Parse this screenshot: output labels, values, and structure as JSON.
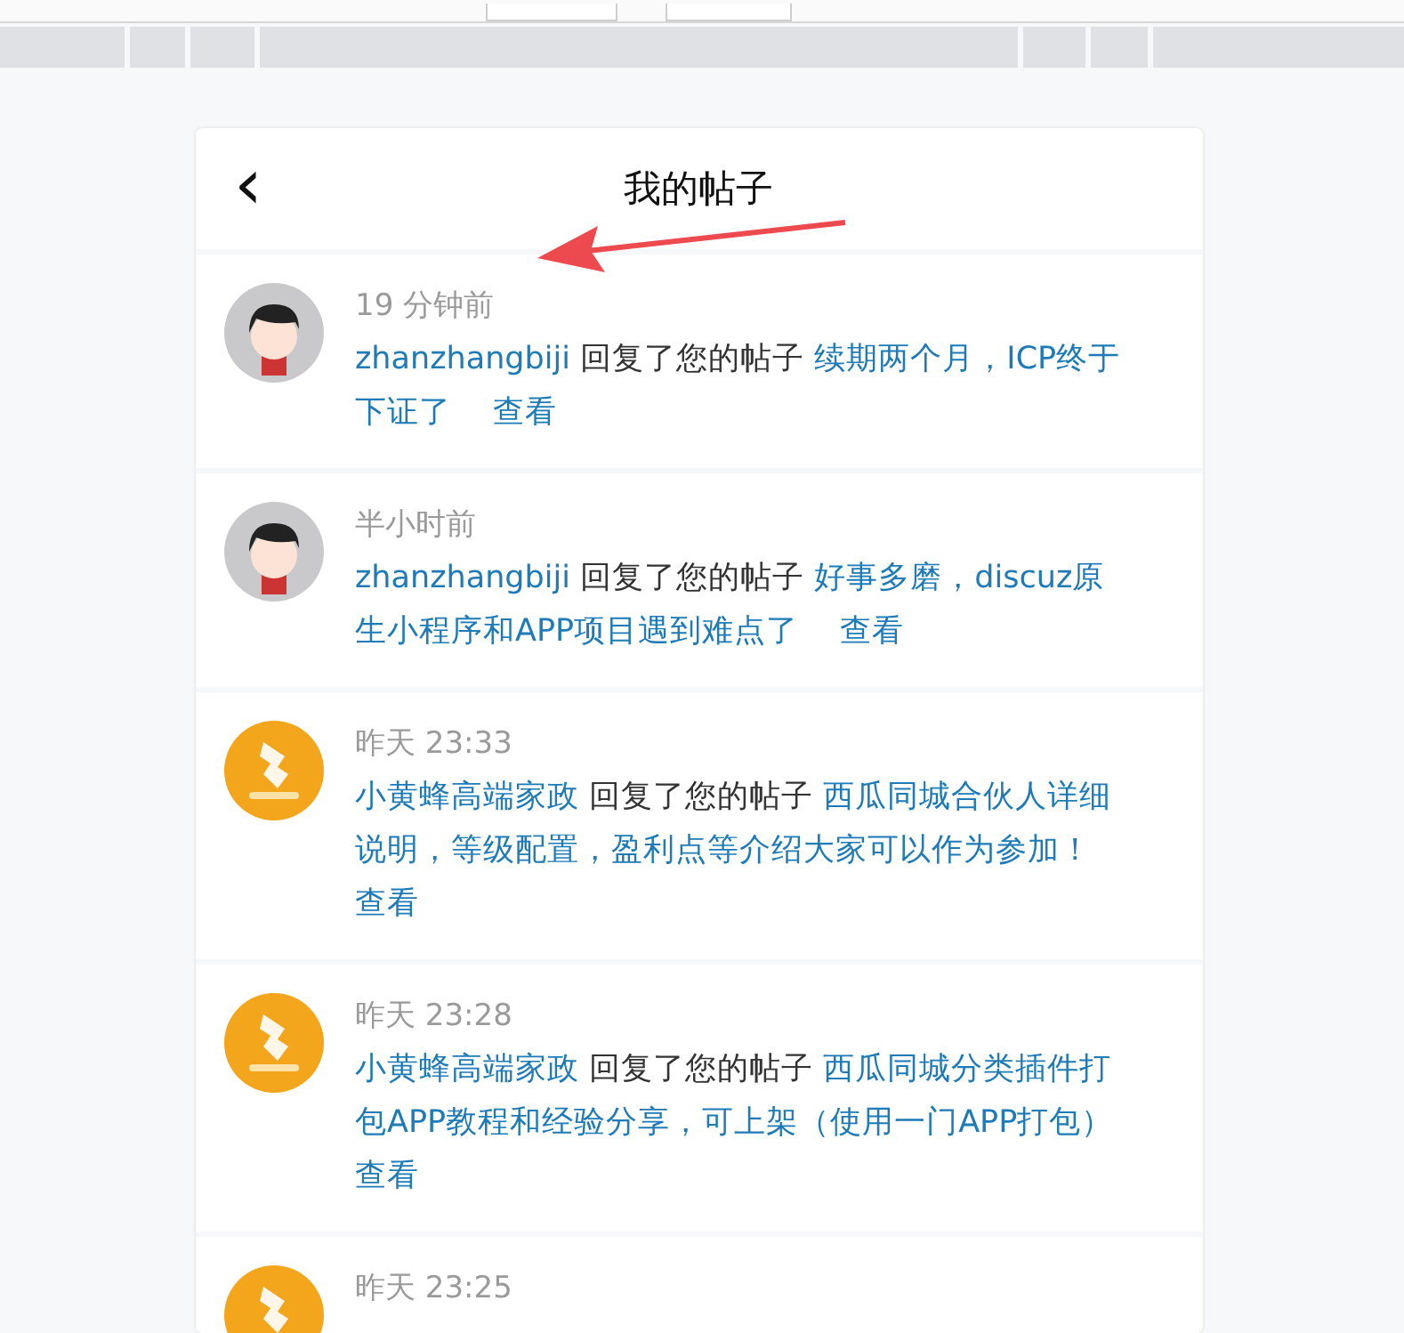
{
  "header": {
    "title": "我的帖子",
    "back": "‹"
  },
  "items": [
    {
      "kind": "cartoon",
      "time": "19 分钟前",
      "user": "zhanzhangbiji",
      "action": "回复了您的帖子",
      "post": "续期两个月，ICP终于下证了",
      "view": "查看"
    },
    {
      "kind": "cartoon",
      "time": "半小时前",
      "user": "zhanzhangbiji",
      "action": "回复了您的帖子",
      "post": "好事多磨，discuz原生小程序和APP项目遇到难点了",
      "view": "查看"
    },
    {
      "kind": "logo",
      "time": "昨天 23:33",
      "user": "小黄蜂高端家政",
      "action": "回复了您的帖子",
      "post": "西瓜同城合伙人详细说明，等级配置，盈利点等介绍大家可以作为参加！",
      "view": "查看"
    },
    {
      "kind": "logo",
      "time": "昨天 23:28",
      "user": "小黄蜂高端家政",
      "action": "回复了您的帖子",
      "post": "西瓜同城分类插件打包APP教程和经验分享，可上架（使用一门APP打包）",
      "view": "查看"
    },
    {
      "kind": "logo",
      "time": "昨天 23:25"
    }
  ]
}
